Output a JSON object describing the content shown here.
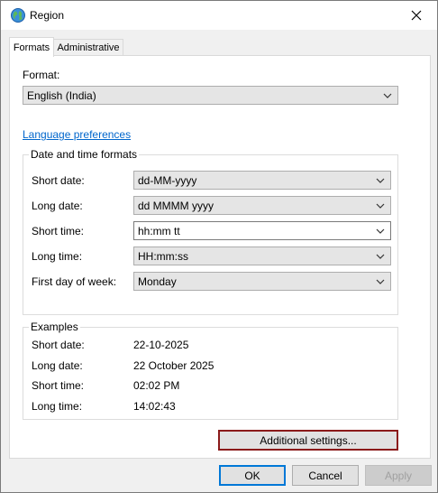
{
  "window": {
    "title": "Region"
  },
  "tabs": [
    {
      "label": "Formats",
      "active": true
    },
    {
      "label": "Administrative",
      "active": false
    }
  ],
  "format": {
    "label": "Format:",
    "value": "English (India)"
  },
  "language_preferences_link": "Language preferences",
  "date_time_formats": {
    "title": "Date and time formats",
    "rows": [
      {
        "label": "Short date:",
        "value": "dd-MM-yyyy"
      },
      {
        "label": "Long date:",
        "value": "dd MMMM yyyy"
      },
      {
        "label": "Short time:",
        "value": "hh:mm tt"
      },
      {
        "label": "Long time:",
        "value": "HH:mm:ss"
      },
      {
        "label": "First day of week:",
        "value": "Monday"
      }
    ]
  },
  "examples": {
    "title": "Examples",
    "rows": [
      {
        "label": "Short date:",
        "value": "22-10-2025"
      },
      {
        "label": "Long date:",
        "value": "22 October 2025"
      },
      {
        "label": "Short time:",
        "value": "02:02 PM"
      },
      {
        "label": "Long time:",
        "value": "14:02:43"
      }
    ]
  },
  "buttons": {
    "additional_settings": "Additional settings...",
    "ok": "OK",
    "cancel": "Cancel",
    "apply": "Apply"
  },
  "colors": {
    "link": "#0066cc",
    "focus_outline": "#8b1a1a",
    "default_button_border": "#0078d7"
  },
  "icons": {
    "title": "globe-icon",
    "close": "close-icon",
    "dropdown": "chevron-down-icon"
  }
}
